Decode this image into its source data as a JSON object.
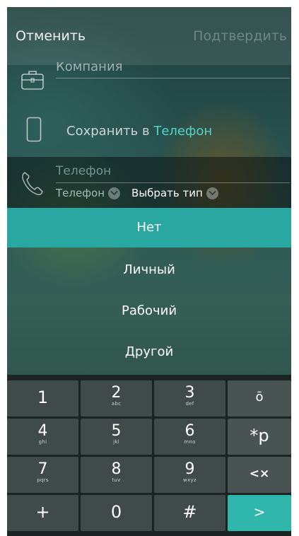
{
  "header": {
    "cancel": "Отменить",
    "confirm": "Подтвердить"
  },
  "form": {
    "company_placeholder": "Компания",
    "save_label": "Сохранить в",
    "save_target": "Телефон",
    "phone_placeholder": "Телефон",
    "phone_type": "Телефон",
    "pick_type": "Выбрать тип"
  },
  "dropdown": {
    "options": [
      {
        "label": "Нет",
        "selected": true
      },
      {
        "label": "Личный"
      },
      {
        "label": "Рабочий"
      },
      {
        "label": "Другой"
      }
    ]
  },
  "keypad": {
    "keys": [
      {
        "digit": "1",
        "letters": ""
      },
      {
        "digit": "2",
        "letters": "abc"
      },
      {
        "digit": "3",
        "letters": "def"
      },
      {
        "digit": "4",
        "letters": "ghi"
      },
      {
        "digit": "5",
        "letters": "jkl"
      },
      {
        "digit": "6",
        "letters": "mno"
      },
      {
        "digit": "7",
        "letters": "pqrs"
      },
      {
        "digit": "8",
        "letters": "tuv"
      },
      {
        "digit": "9",
        "letters": "wxyz"
      },
      {
        "digit": "+",
        "letters": ""
      },
      {
        "digit": "0",
        "letters": ""
      },
      {
        "digit": "#",
        "letters": ""
      }
    ],
    "side": {
      "hide": "ō",
      "star_p": "*p",
      "backspace": "<×",
      "next": ">"
    }
  },
  "colors": {
    "accent": "#2aa7a0",
    "save_target": "#52d4c4",
    "next_key": "#2fb7ac"
  }
}
